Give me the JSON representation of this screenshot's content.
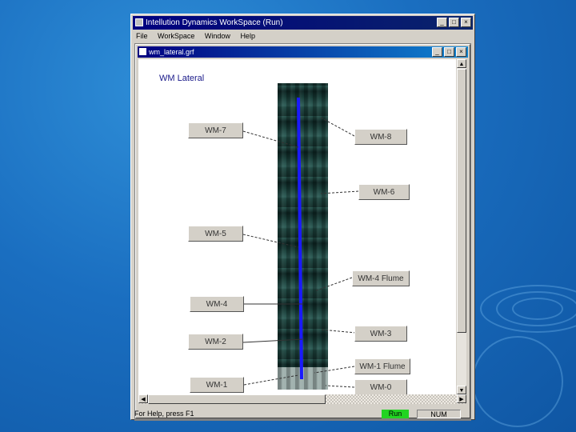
{
  "window": {
    "title": "Intellution Dynamics WorkSpace (Run)",
    "controls": [
      "_",
      "□",
      "×"
    ]
  },
  "menu": [
    "File",
    "WorkSpace",
    "Window",
    "Help"
  ],
  "child_window": {
    "title": "wm_lateral.grf",
    "controls": [
      "_",
      "□",
      "×"
    ]
  },
  "canvas": {
    "title": "WM Lateral",
    "labels": {
      "wm7": "WM-7",
      "wm8": "WM-8",
      "wm6": "WM-6",
      "wm5": "WM-5",
      "wm4flume": "WM-4 Flume",
      "wm4": "WM-4",
      "wm3": "WM-3",
      "wm2": "WM-2",
      "wm1flume": "WM-1 Flume",
      "wm1": "WM-1",
      "wm0": "WM-0"
    }
  },
  "statusbar": {
    "help": "For Help, press F1",
    "mode": "Run",
    "num": "NUM",
    "mode_color": "#22d422"
  },
  "colors": {
    "title_bar": "#000080",
    "canal_line": "#1a1aff"
  }
}
